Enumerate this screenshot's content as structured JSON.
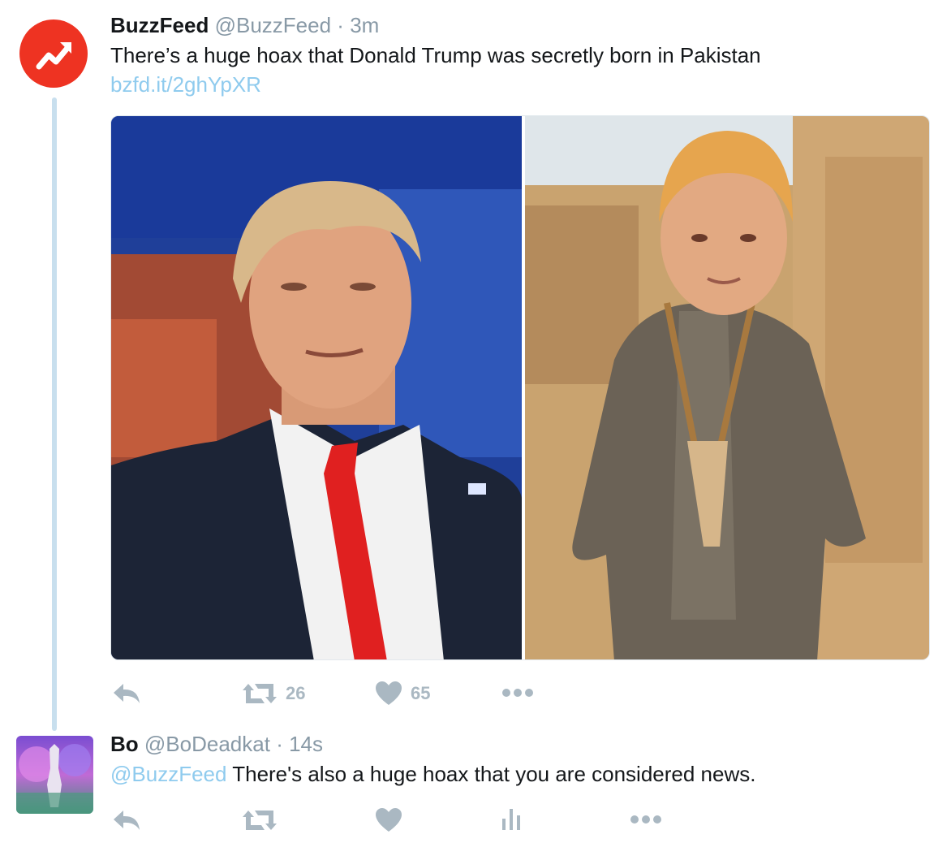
{
  "colors": {
    "buzzfeed_red": "#ee3322",
    "link_blue": "#8fcbee",
    "muted_gray": "#8899a6",
    "icon_gray": "#aab8c2",
    "thread_line": "#c8dfee"
  },
  "tweet1": {
    "name": "BuzzFeed",
    "handle": "@BuzzFeed",
    "separator": "·",
    "time": "3m",
    "text": "There’s a huge hoax that Donald Trump was secretly born in Pakistan",
    "link": "bzfd.it/2ghYpXR",
    "avatar_icon": "trending-arrow-icon",
    "retweets": "26",
    "likes": "65"
  },
  "tweet2": {
    "name": "Bo",
    "handle": "@BoDeadkat",
    "separator": "·",
    "time": "14s",
    "mention": "@BuzzFeed",
    "text": " There's also a huge hoax that you are considered news."
  },
  "icons": {
    "reply": "reply-icon",
    "retweet": "retweet-icon",
    "like": "heart-icon",
    "more": "more-icon",
    "analytics": "analytics-icon"
  }
}
